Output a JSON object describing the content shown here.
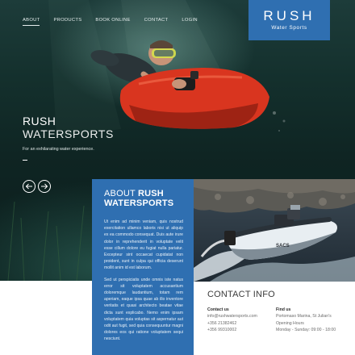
{
  "nav": {
    "items": [
      {
        "label": "ABOUT",
        "active": true
      },
      {
        "label": "PRODUCTS",
        "active": false
      },
      {
        "label": "BOOK ONLINE",
        "active": false
      },
      {
        "label": "CONTACT",
        "active": false
      },
      {
        "label": "LOGIN",
        "active": false
      }
    ]
  },
  "logo": {
    "main": "RUSH",
    "sub": "Water Sports"
  },
  "hero": {
    "title_line1": "RUSH",
    "title_line2": "WATERSPORTS",
    "subtitle": "For an exhilarating water experience.",
    "prev_icon": "arrow-left-icon",
    "next_icon": "arrow-right-icon"
  },
  "about": {
    "title_prefix": "ABOUT",
    "title_brand": "RUSH",
    "title_line2": "WATERSPORTS",
    "paragraph1": "Ut enim ad minim veniam, quis nostrud exercitation ullamco laboris nisi ut aliquip ex ea commodo consequat. Duis aute irure dolor in reprehenderit in voluptate velit esse cillum dolore eu fugiat nulla pariatur. Excepteur sint occaecat cupidatat non proident, sunt in culpa qui officia deserunt mollit anim id est laborum.",
    "paragraph2": "Sed ut perspiciatis unde omnis iste natus error sit voluptatem accusantium doloremque laudantium, totam rem aperiam, eaque ipsa quae ab illo inventore veritatis et quasi architecto beatae vitae dicta sunt explicabo. Nemo enim ipsam voluptatem quia voluptas sit aspernatur aut odit aut fugit, sed quia consequuntur magni dolores eos qui ratione voluptatem sequi nesciunt."
  },
  "contact": {
    "title": "CONTACT INFO",
    "contact_us": {
      "heading": "Contact us",
      "email": "info@rushwatersports.com",
      "phone1": "+356 21382462",
      "phone2": "+356 99310002"
    },
    "find_us": {
      "heading": "Find us",
      "address": "Portomaso Marina, St Julian's",
      "hours_label": "Opening Hours",
      "hours": "Monday - Sunday: 09:00 - 18:00"
    }
  },
  "colors": {
    "brand_blue": "#2f6fb1",
    "hero_dark": "#14302d",
    "scooter_red": "#d9351f"
  }
}
